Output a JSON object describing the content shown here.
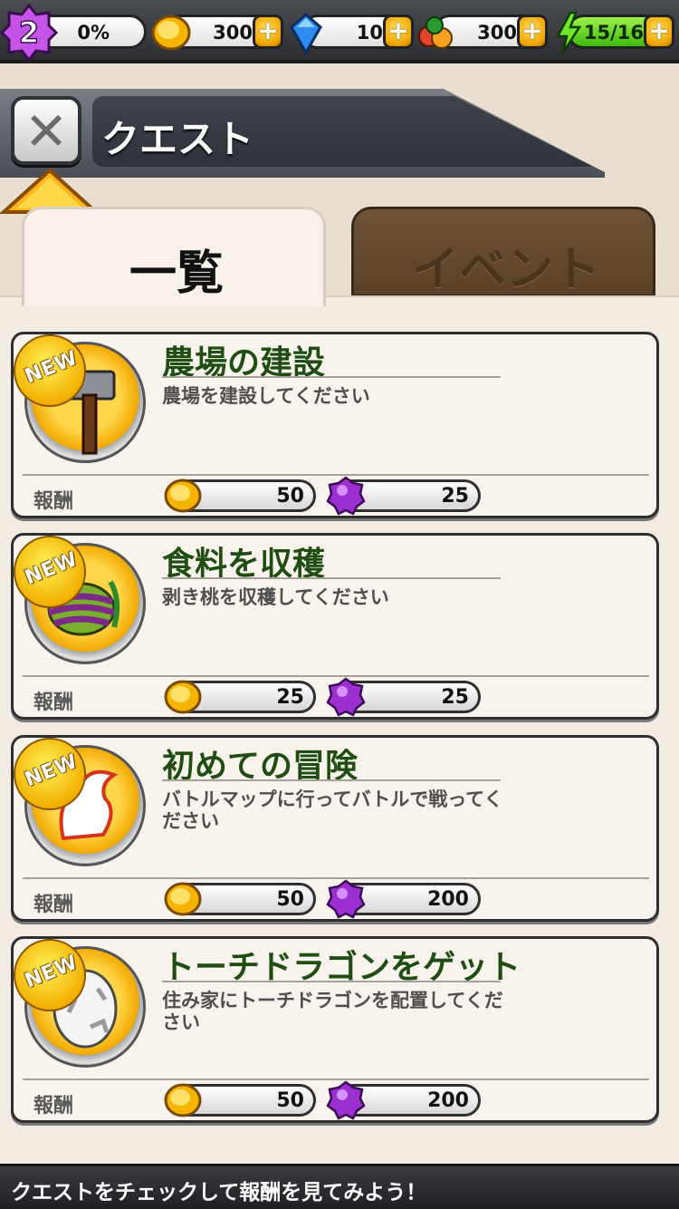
{
  "status_bar": {
    "level": "2",
    "progress": "0%",
    "coins": "300",
    "gems": "10",
    "food": "300",
    "energy": "15/16"
  },
  "header": {
    "title": "クエスト",
    "close_icon": "close-x-icon"
  },
  "tabs": [
    {
      "label": "一覧",
      "active": true
    },
    {
      "label": "イベント",
      "active": false
    }
  ],
  "reward_label": "報酬",
  "new_badge": "NEW",
  "quests": [
    {
      "title": "農場の建設",
      "description": "農場を建設してください",
      "icon": "hammer-icon",
      "coins": "50",
      "gems": "25"
    },
    {
      "title": "食料を収穫",
      "description": "剥き桃を収穫してください",
      "icon": "fruit-icon",
      "coins": "25",
      "gems": "25"
    },
    {
      "title": "初めての冒険",
      "description": "バトルマップに行ってバトルで戦ってください",
      "icon": "dragon-icon",
      "coins": "50",
      "gems": "200"
    },
    {
      "title": "トーチドラゴンをゲット",
      "description": "住み家にトーチドラゴンを配置してください",
      "icon": "egg-icon",
      "coins": "50",
      "gems": "200"
    }
  ],
  "tip": "クエストをチェックして報酬を見てみよう！",
  "colors": {
    "title_green": "#1f4d12",
    "gold": "#f2a900",
    "gem_purple": "#9b2fd1",
    "energy_green": "#3fba0c"
  }
}
